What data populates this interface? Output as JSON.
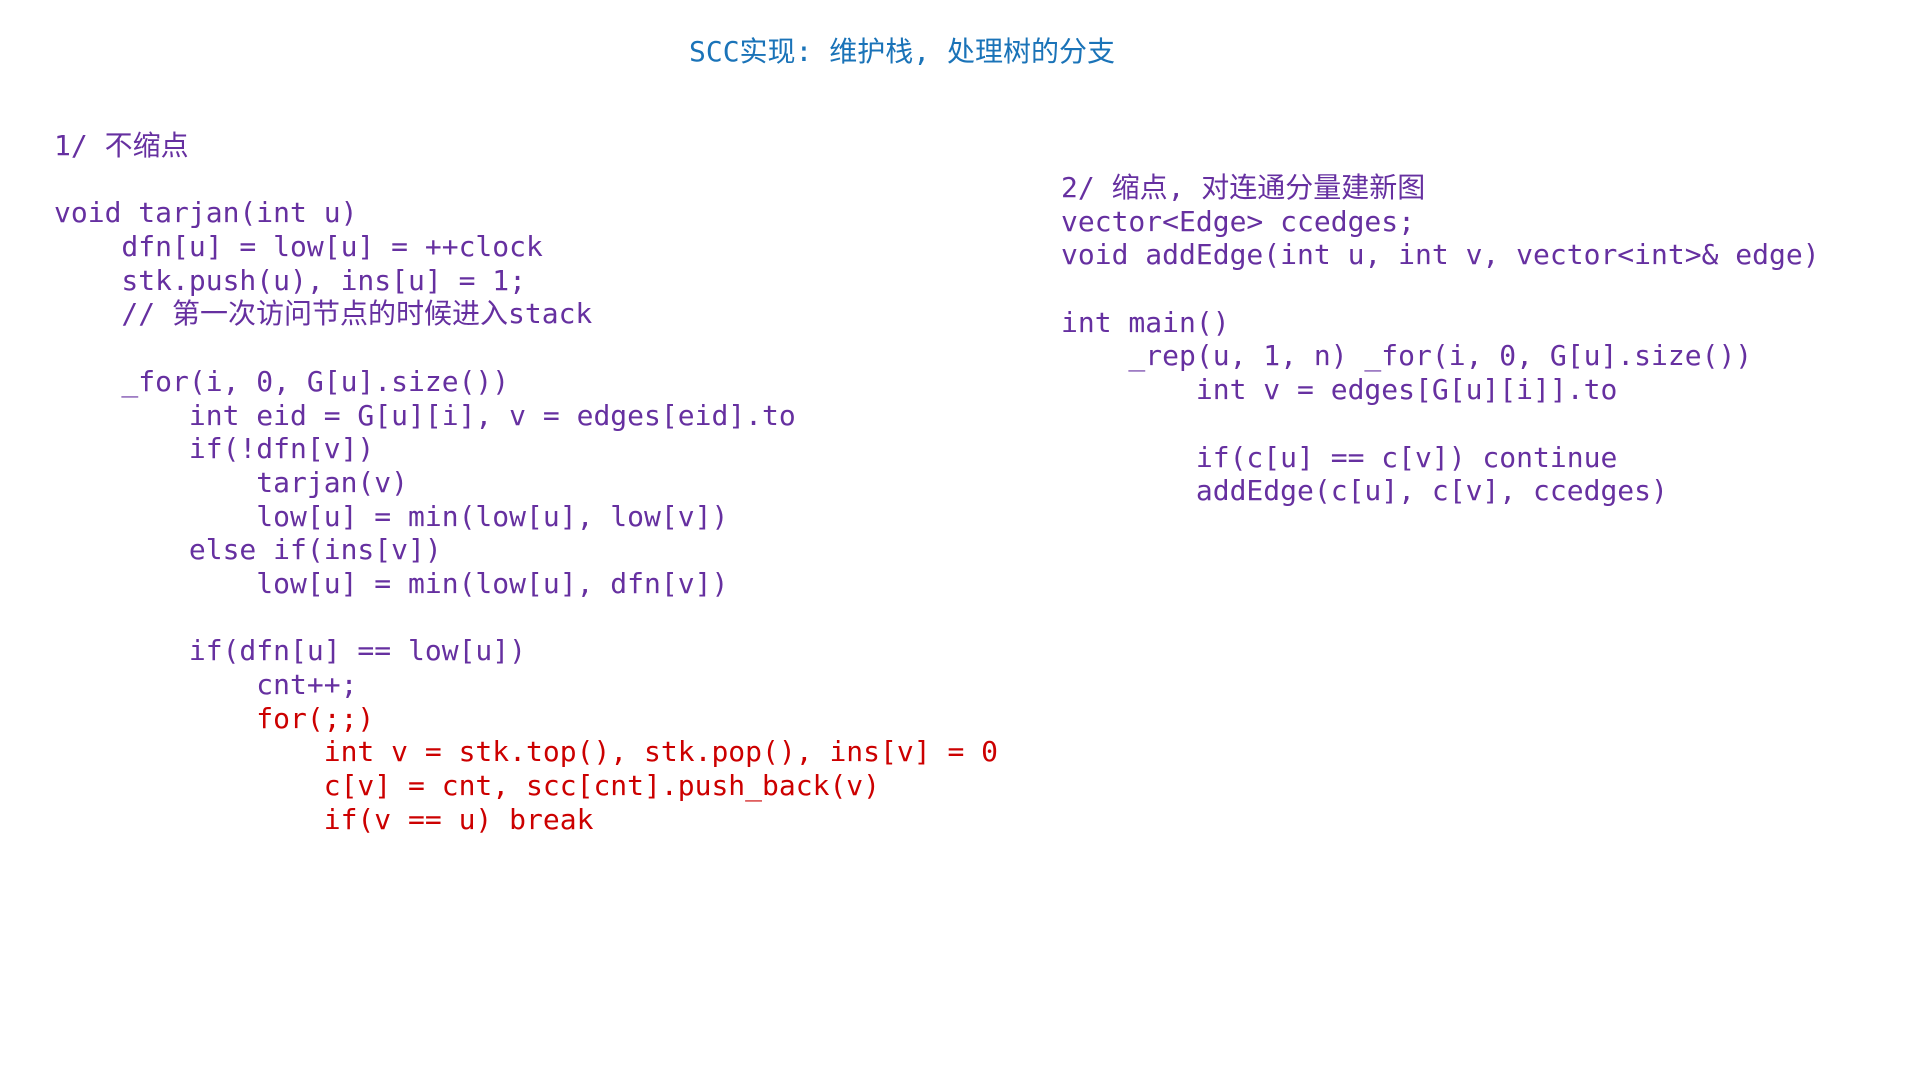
{
  "title": "SCC实现: 维护栈, 处理树的分支",
  "colors": {
    "title": "#1a73b8",
    "code": "#6630a0",
    "highlight": "#cc0000"
  },
  "left": {
    "lines": [
      {
        "text": "1/ 不缩点",
        "red": false
      },
      {
        "text": "",
        "red": false
      },
      {
        "text": "void tarjan(int u)",
        "red": false
      },
      {
        "text": "    dfn[u] = low[u] = ++clock",
        "red": false
      },
      {
        "text": "    stk.push(u), ins[u] = 1;",
        "red": false
      },
      {
        "text": "    // 第一次访问节点的时候进入stack",
        "red": false
      },
      {
        "text": "",
        "red": false
      },
      {
        "text": "    _for(i, 0, G[u].size())",
        "red": false
      },
      {
        "text": "        int eid = G[u][i], v = edges[eid].to",
        "red": false
      },
      {
        "text": "        if(!dfn[v])",
        "red": false
      },
      {
        "text": "            tarjan(v)",
        "red": false
      },
      {
        "text": "            low[u] = min(low[u], low[v])",
        "red": false
      },
      {
        "text": "        else if(ins[v])",
        "red": false
      },
      {
        "text": "            low[u] = min(low[u], dfn[v])",
        "red": false
      },
      {
        "text": "",
        "red": false
      },
      {
        "text": "        if(dfn[u] == low[u])",
        "red": false
      },
      {
        "text": "            cnt++;",
        "red": false
      },
      {
        "text": "            for(;;)",
        "red": true
      },
      {
        "text": "                int v = stk.top(), stk.pop(), ins[v] = 0",
        "red": true
      },
      {
        "text": "                c[v] = cnt, scc[cnt].push_back(v)",
        "red": true
      },
      {
        "text": "                if(v == u) break",
        "red": true
      }
    ]
  },
  "right": {
    "lines": [
      {
        "text": "2/ 缩点, 对连通分量建新图",
        "red": false
      },
      {
        "text": "vector<Edge> ccedges;",
        "red": false
      },
      {
        "text": "void addEdge(int u, int v, vector<int>& edge)",
        "red": false
      },
      {
        "text": "",
        "red": false
      },
      {
        "text": "int main()",
        "red": false
      },
      {
        "text": "    _rep(u, 1, n) _for(i, 0, G[u].size())",
        "red": false
      },
      {
        "text": "        int v = edges[G[u][i]].to",
        "red": false
      },
      {
        "text": "",
        "red": false
      },
      {
        "text": "        if(c[u] == c[v]) continue",
        "red": false
      },
      {
        "text": "        addEdge(c[u], c[v], ccedges)",
        "red": false
      }
    ]
  }
}
